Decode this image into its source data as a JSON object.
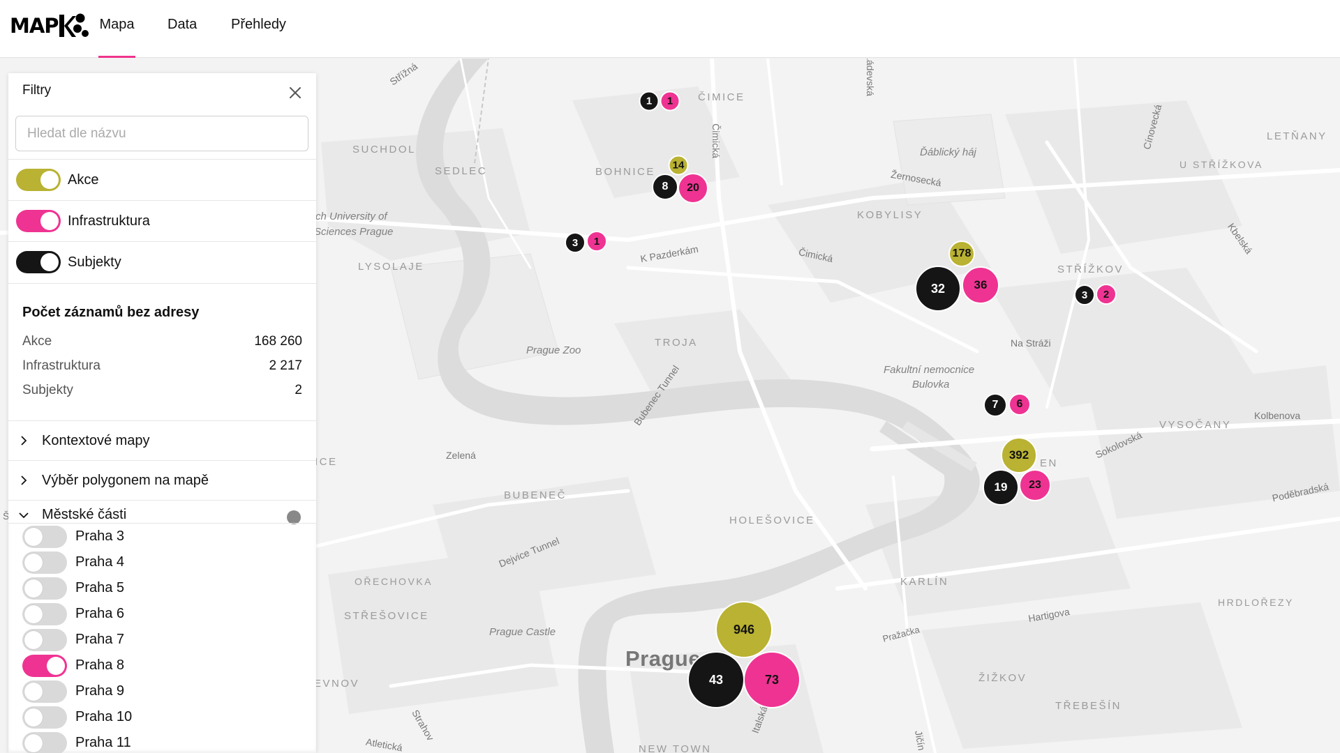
{
  "app": {
    "logo_text": "MAP",
    "nav": {
      "tabs": [
        {
          "label": "Mapa",
          "active": true
        },
        {
          "label": "Data",
          "active": false
        },
        {
          "label": "Přehledy",
          "active": false
        }
      ]
    }
  },
  "colors": {
    "accent": "#f0338c",
    "akce": "#b9b232",
    "infrastruktura": "#ef3392",
    "subjekty": "#151515"
  },
  "panel": {
    "title": "Filtry",
    "close_icon": "close-icon",
    "search_placeholder": "Hledat dle názvu",
    "search_value": "",
    "layers": [
      {
        "label": "Akce",
        "enabled": true,
        "color": "#b9b232"
      },
      {
        "label": "Infrastruktura",
        "enabled": true,
        "color": "#ef3392"
      },
      {
        "label": "Subjekty",
        "enabled": true,
        "color": "#151515"
      }
    ],
    "stats": {
      "title": "Počet záznamů bez adresy",
      "rows": [
        {
          "label": "Akce",
          "value": "168 260"
        },
        {
          "label": "Infrastruktura",
          "value": "2 217"
        },
        {
          "label": "Subjekty",
          "value": "2"
        }
      ]
    },
    "accordions": [
      {
        "label": "Kontextové mapy",
        "expanded": false
      },
      {
        "label": "Výběr polygonem na mapě",
        "expanded": false
      },
      {
        "label": "Městské části",
        "expanded": true
      }
    ],
    "districts": [
      {
        "label": "Praha 3",
        "enabled": false
      },
      {
        "label": "Praha 4",
        "enabled": false
      },
      {
        "label": "Praha 5",
        "enabled": false
      },
      {
        "label": "Praha 6",
        "enabled": false
      },
      {
        "label": "Praha 7",
        "enabled": false
      },
      {
        "label": "Praha 8",
        "enabled": true
      },
      {
        "label": "Praha 9",
        "enabled": false
      },
      {
        "label": "Praha 10",
        "enabled": false
      },
      {
        "label": "Praha 11",
        "enabled": false
      }
    ]
  },
  "map": {
    "labels": [
      "Střížná",
      "SUCHDOL",
      "SEDLEC",
      "BOHNICE",
      "ČIMICE",
      "Čimická",
      "Ládevská",
      "Ďáblický háj",
      "Žernosecká",
      "KOBYLISY",
      "LETŇANY",
      "U STŘÍŽKOVA",
      "Cínovecká",
      "Kbelská",
      "STŘÍŽKOV",
      "ch University of",
      "Sciences Prague",
      "LYSOLAJE",
      "K Pazderkám",
      "Čimická",
      "Prague Zoo",
      "TROJA",
      "Na Stráži",
      "Fakultní nemocnice",
      "Bulovka",
      "Bubenec Tunnel",
      "VYSOČANY",
      "Kolbenova",
      "Sokolovská",
      "Zelená",
      "ICE",
      "BUBENEČ",
      "HOLEŠOVICE",
      "Poděbradská",
      "Dejvice Tunnel",
      "OŘECHOVKA",
      "KARLÍN",
      "STŘEŠOVICE",
      "Hartigova",
      "HRDLOŘEZY",
      "Prague Castle",
      "Pražačka",
      "Prague",
      "EVNOV",
      "ŽIŽKOV",
      "TŘEBEŠÍN",
      "Strahov",
      "Italská",
      "Atletická",
      "NEW TOWN",
      "Jičín",
      "EN",
      "Š"
    ],
    "clusters": [
      {
        "type": "subjekty",
        "count": "1"
      },
      {
        "type": "infrastruktura",
        "count": "1"
      },
      {
        "type": "akce",
        "count": "14"
      },
      {
        "type": "subjekty",
        "count": "8"
      },
      {
        "type": "infrastruktura",
        "count": "20"
      },
      {
        "type": "subjekty",
        "count": "3"
      },
      {
        "type": "infrastruktura",
        "count": "1"
      },
      {
        "type": "akce",
        "count": "178"
      },
      {
        "type": "subjekty",
        "count": "32"
      },
      {
        "type": "infrastruktura",
        "count": "36"
      },
      {
        "type": "subjekty",
        "count": "3"
      },
      {
        "type": "infrastruktura",
        "count": "2"
      },
      {
        "type": "subjekty",
        "count": "7"
      },
      {
        "type": "infrastruktura",
        "count": "6"
      },
      {
        "type": "akce",
        "count": "392"
      },
      {
        "type": "subjekty",
        "count": "19"
      },
      {
        "type": "infrastruktura",
        "count": "23"
      },
      {
        "type": "akce",
        "count": "946"
      },
      {
        "type": "subjekty",
        "count": "43"
      },
      {
        "type": "infrastruktura",
        "count": "73"
      }
    ]
  }
}
